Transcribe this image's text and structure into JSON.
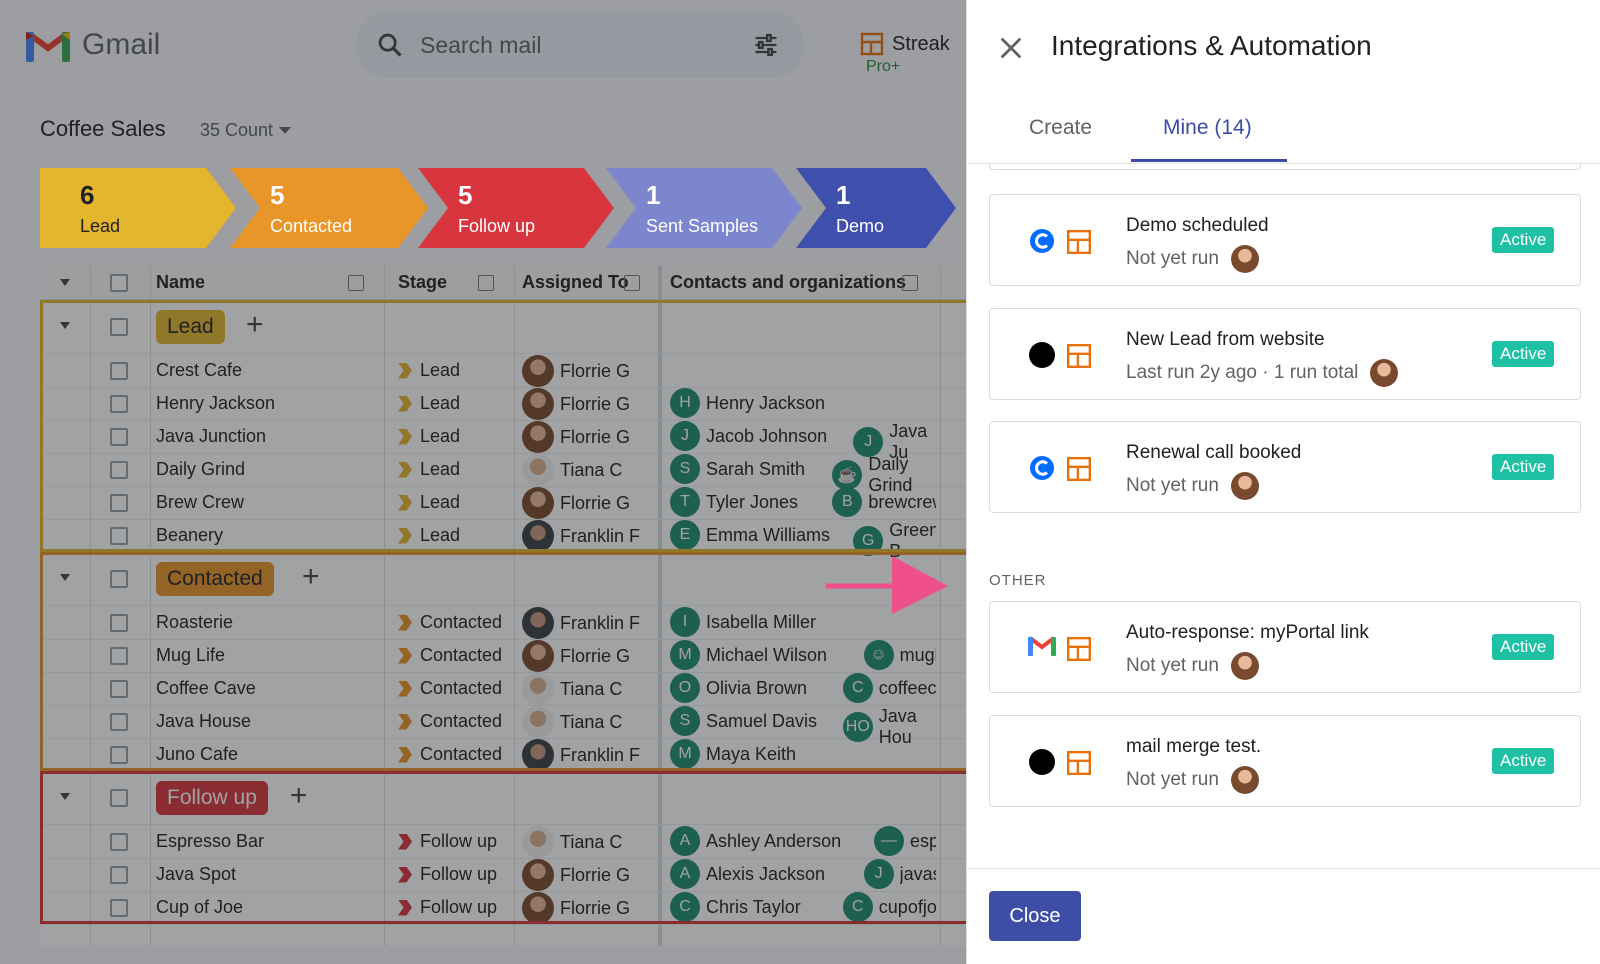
{
  "app": {
    "name": "Gmail"
  },
  "search": {
    "placeholder": "Search mail"
  },
  "streak": {
    "name": "Streak",
    "plan": "Pro+"
  },
  "pipeline": {
    "title": "Coffee Sales",
    "count_label": "35 Count"
  },
  "stages": [
    {
      "count": "6",
      "label": "Lead",
      "color": "#e3b62e"
    },
    {
      "count": "5",
      "label": "Contacted",
      "color": "#e8952a"
    },
    {
      "count": "5",
      "label": "Follow up",
      "color": "#d7343d"
    },
    {
      "count": "1",
      "label": "Sent Samples",
      "color": "#7b86cf"
    },
    {
      "count": "1",
      "label": "Demo",
      "color": "#3f4fae"
    }
  ],
  "columns": {
    "name": "Name",
    "stage": "Stage",
    "assigned": "Assigned To",
    "contacts": "Contacts and organizations"
  },
  "groups": [
    {
      "label": "Lead",
      "color": "#e3b62e",
      "chev_color": "#e3b62e",
      "rows": [
        {
          "name": "Crest Cafe",
          "stage": "Lead",
          "assigned": "Florrie G",
          "av": "f",
          "c1i": "",
          "c1": "",
          "c2i": "",
          "c2": ""
        },
        {
          "name": "Henry Jackson",
          "stage": "Lead",
          "assigned": "Florrie G",
          "av": "f",
          "c1i": "H",
          "c1": "Henry Jackson",
          "c2i": "",
          "c2": ""
        },
        {
          "name": "Java Junction",
          "stage": "Lead",
          "assigned": "Florrie G",
          "av": "f",
          "c1i": "J",
          "c1": "Jacob Johnson",
          "c2i": "J",
          "c2": "Java Ju"
        },
        {
          "name": "Daily Grind",
          "stage": "Lead",
          "assigned": "Tiana C",
          "av": "t",
          "c1i": "S",
          "c1": "Sarah Smith",
          "c2i": "☕",
          "c2": "Daily Grind"
        },
        {
          "name": "Brew Crew",
          "stage": "Lead",
          "assigned": "Florrie G",
          "av": "f",
          "c1i": "T",
          "c1": "Tyler Jones",
          "c2i": "B",
          "c2": "brewcrew.c"
        },
        {
          "name": "Beanery",
          "stage": "Lead",
          "assigned": "Franklin F",
          "av": "k",
          "c1i": "E",
          "c1": "Emma Williams",
          "c2i": "G",
          "c2": "Green B"
        }
      ]
    },
    {
      "label": "Contacted",
      "color": "#e8952a",
      "chev_color": "#e8952a",
      "rows": [
        {
          "name": "Roasterie",
          "stage": "Contacted",
          "assigned": "Franklin F",
          "av": "k",
          "c1i": "I",
          "c1": "Isabella Miller",
          "c2i": "",
          "c2": ""
        },
        {
          "name": "Mug Life",
          "stage": "Contacted",
          "assigned": "Florrie G",
          "av": "f",
          "c1i": "M",
          "c1": "Michael Wilson",
          "c2i": "☺",
          "c2": "muglife"
        },
        {
          "name": "Coffee Cave",
          "stage": "Contacted",
          "assigned": "Tiana C",
          "av": "t",
          "c1i": "O",
          "c1": "Olivia Brown",
          "c2i": "C",
          "c2": "coffeecave"
        },
        {
          "name": "Java House",
          "stage": "Contacted",
          "assigned": "Tiana C",
          "av": "t",
          "c1i": "S",
          "c1": "Samuel Davis",
          "c2i": "HO",
          "c2": "Java Hou"
        },
        {
          "name": "Juno Cafe",
          "stage": "Contacted",
          "assigned": "Franklin F",
          "av": "k",
          "c1i": "M",
          "c1": "Maya Keith",
          "c2i": "",
          "c2": ""
        }
      ]
    },
    {
      "label": "Follow up",
      "color": "#d7343d",
      "chev_color": "#d7343d",
      "rows": [
        {
          "name": "Espresso Bar",
          "stage": "Follow up",
          "assigned": "Tiana C",
          "av": "t",
          "c1i": "A",
          "c1": "Ashley Anderson",
          "c2i": "—",
          "c2": "espres"
        },
        {
          "name": "Java Spot",
          "stage": "Follow up",
          "assigned": "Florrie G",
          "av": "f",
          "c1i": "A",
          "c1": "Alexis Jackson",
          "c2i": "J",
          "c2": "javaspot"
        },
        {
          "name": "Cup of Joe",
          "stage": "Follow up",
          "assigned": "Florrie G",
          "av": "f",
          "c1i": "C",
          "c1": "Chris Taylor",
          "c2i": "C",
          "c2": "cupofjoe.co"
        }
      ]
    }
  ],
  "panel": {
    "title": "Integrations & Automation",
    "tabs": [
      {
        "label": "Create"
      },
      {
        "label": "Mine (14)"
      }
    ],
    "section_other": "OTHER",
    "cards": [
      {
        "name": "Demo scheduled",
        "meta": "Not yet run",
        "status": "Active",
        "source_icon": "calendly-icon"
      },
      {
        "name": "New Lead from website",
        "meta": "Last run 2y ago · 1 run total",
        "status": "Active",
        "source_icon": "black-circle-icon"
      },
      {
        "name": "Renewal call booked",
        "meta": "Not yet run",
        "status": "Active",
        "source_icon": "calendly-icon"
      },
      {
        "name": "Auto-response: myPortal link",
        "meta": "Not yet run",
        "status": "Active",
        "source_icon": "gmail-icon"
      },
      {
        "name": "mail merge test.",
        "meta": "Not yet run",
        "status": "Active",
        "source_icon": "black-circle-icon"
      }
    ],
    "close_label": "Close"
  }
}
